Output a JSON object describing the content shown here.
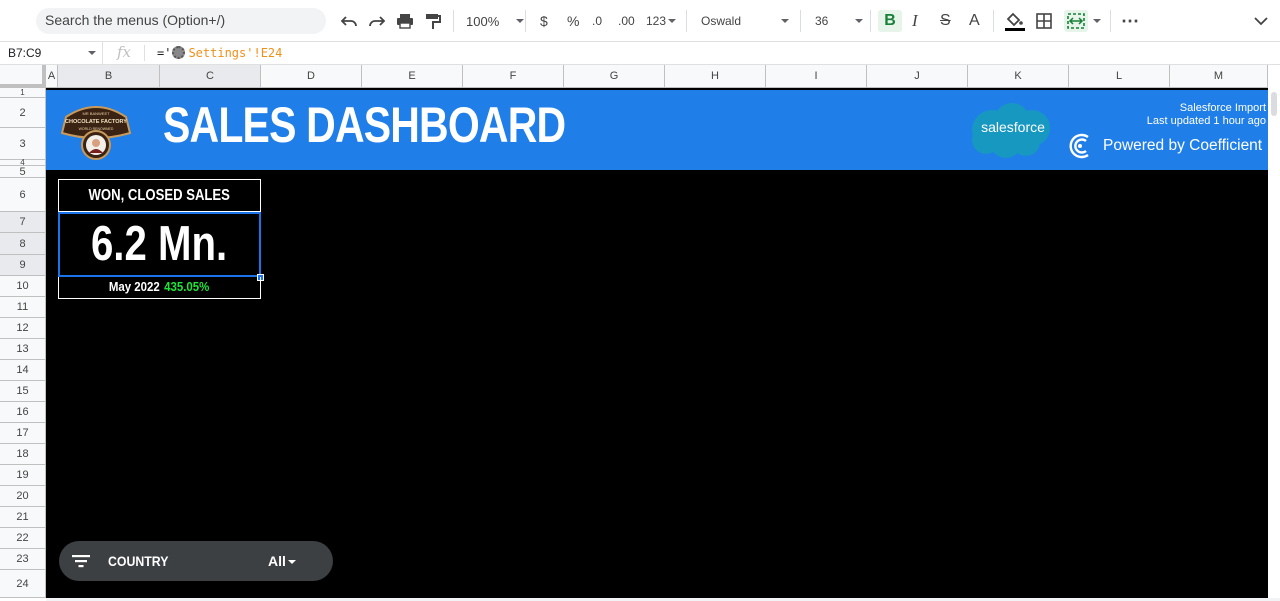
{
  "toolbar": {
    "search_placeholder": "Search the menus (Option+/)",
    "zoom": "100%",
    "currency": "$",
    "percent": "%",
    "decrease_decimal": ".0",
    "increase_decimal": ".00",
    "number_format": "123",
    "font": "Oswald",
    "font_size": "36",
    "bold": "B",
    "italic": "I",
    "strike": "S",
    "text_color": "A",
    "more": "⋯"
  },
  "formula_bar": {
    "cell_ref": "B7:C9",
    "fx": "fx",
    "formula_prefix": "='",
    "formula_ref": "Settings'!E24"
  },
  "columns": [
    "A",
    "B",
    "C",
    "D",
    "E",
    "F",
    "G",
    "H",
    "I",
    "J",
    "K",
    "L",
    "M"
  ],
  "rows": [
    "1",
    "2",
    "3",
    "4",
    "5",
    "6",
    "7",
    "8",
    "9",
    "10",
    "11",
    "12",
    "13",
    "14",
    "15",
    "16",
    "17",
    "18",
    "19",
    "20",
    "21",
    "22",
    "23",
    "24"
  ],
  "dashboard": {
    "title": "SALES DASHBOARD",
    "salesforce_logo": "salesforce",
    "import_label": "Salesforce Import",
    "updated_label": "Last updated 1 hour ago",
    "powered_by": "Powered by Coefficient",
    "kpi": {
      "title": "WON, CLOSED SALES",
      "value": "6.2 Mn.",
      "period": "May 2022",
      "change": "435.05%"
    },
    "filter": {
      "label": "COUNTRY",
      "value": "All"
    }
  },
  "colors": {
    "banner": "#1f7ee8",
    "sheet_bg": "#000000",
    "change_positive": "#1ee53a",
    "selection": "#1a73e8"
  }
}
